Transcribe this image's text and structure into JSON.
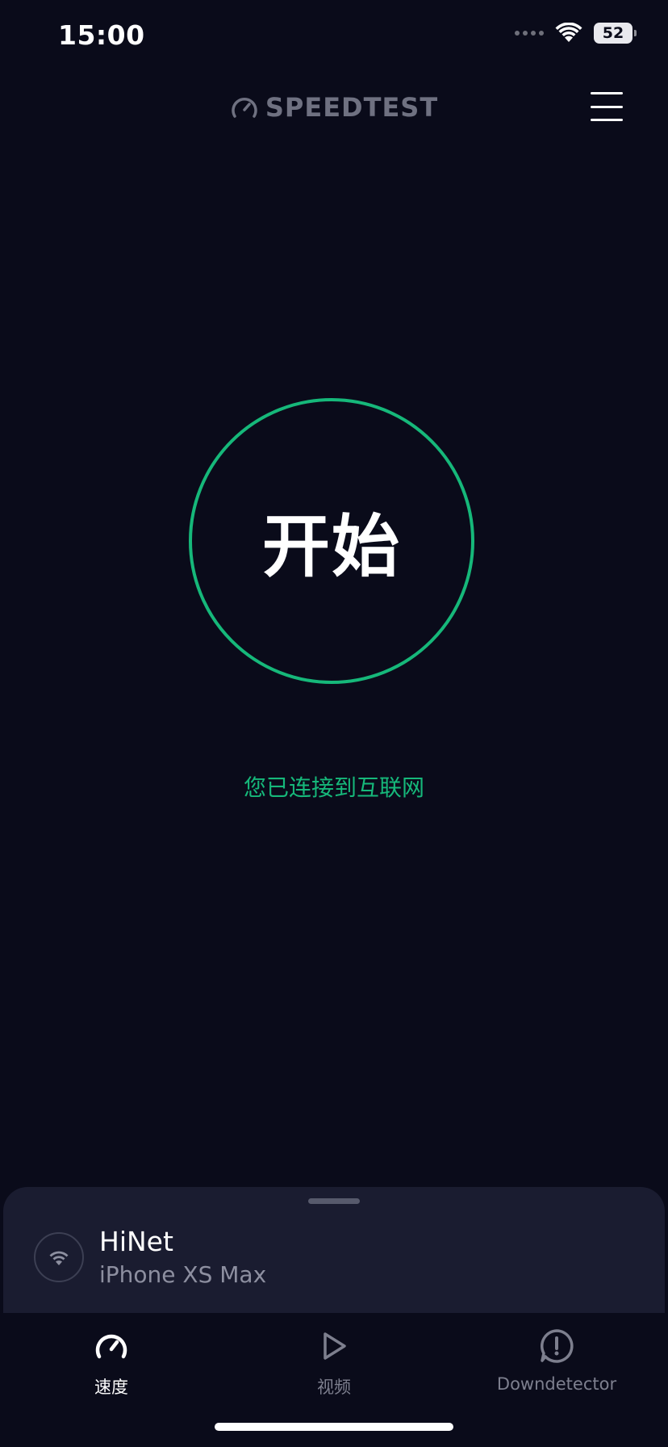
{
  "status_bar": {
    "time": "15:00",
    "battery": "52"
  },
  "header": {
    "brand": "SPEEDTEST",
    "menu_icon": "hamburger-menu-icon"
  },
  "main": {
    "go_label": "开始",
    "connection_status": "您已连接到互联网"
  },
  "connection_sheet": {
    "network_name": "HiNet",
    "device_name": "iPhone XS Max",
    "icon": "wifi-icon"
  },
  "tabs": [
    {
      "label": "速度",
      "icon": "speedometer-icon",
      "active": true
    },
    {
      "label": "视频",
      "icon": "play-icon",
      "active": false
    },
    {
      "label": "Downdetector",
      "icon": "alert-icon",
      "active": false
    }
  ],
  "colors": {
    "background": "#0a0b1a",
    "accent": "#16b87a",
    "sheet": "#1a1c30",
    "muted": "#7d7f8e"
  }
}
